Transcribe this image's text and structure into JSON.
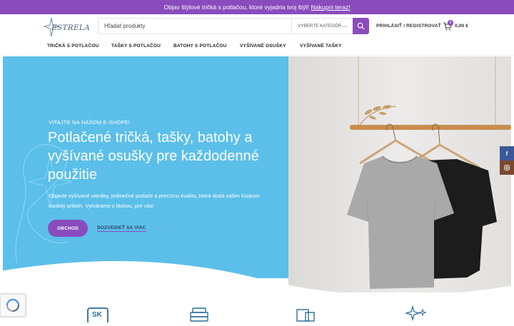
{
  "announcement": {
    "text": "Objav štýlové tričká s potlačou, ktoré vyjadria tvoj štýl!",
    "link": "Nakupni teraz!"
  },
  "header": {
    "logo_text": "ESTRELA",
    "search_placeholder": "Hľadať produkty",
    "category_select": "VYBERTE KATEGÓR...",
    "login_label": "PRIHLÁSIŤ / REGISTROVAŤ",
    "cart_count": "0",
    "cart_total": "0,00 €"
  },
  "nav": {
    "items": [
      {
        "label": "TRIČKÁ S POTLAČOU"
      },
      {
        "label": "TAŠKY S POTLAČOU"
      },
      {
        "label": "BATOHY S POTLAČOU"
      },
      {
        "label": "VYŠÍVANÉ OSUŠKY"
      },
      {
        "label": "VYŠÍVANÉ TAŠKY"
      }
    ]
  },
  "hero": {
    "eyebrow": "VITAJTE NA NAŠOM E-SHOPE!",
    "headline": "Potlačené tričká, tašky, batohy a vyšívané osušky pre každodenné použitie",
    "description": "Objavte vyšívané uteráky, jedinečné potlače a precíznu kvalitu, ktorá dodá vašim kúskom osobitý príbeh. Vytvárame s láskou, pre vás!",
    "primary_button": "OBCHOD",
    "secondary_link": "DOZVEDIEŤ SA VIAC"
  },
  "social": {
    "facebook": "f",
    "instagram_icon": "instagram-icon"
  },
  "features": {
    "sk_badge": "SK"
  },
  "colors": {
    "brand_purple": "#8a4bbd",
    "hero_blue": "#5bbfe9",
    "facebook_blue": "#3b5998",
    "instagram_brown": "#7a4a2e"
  }
}
